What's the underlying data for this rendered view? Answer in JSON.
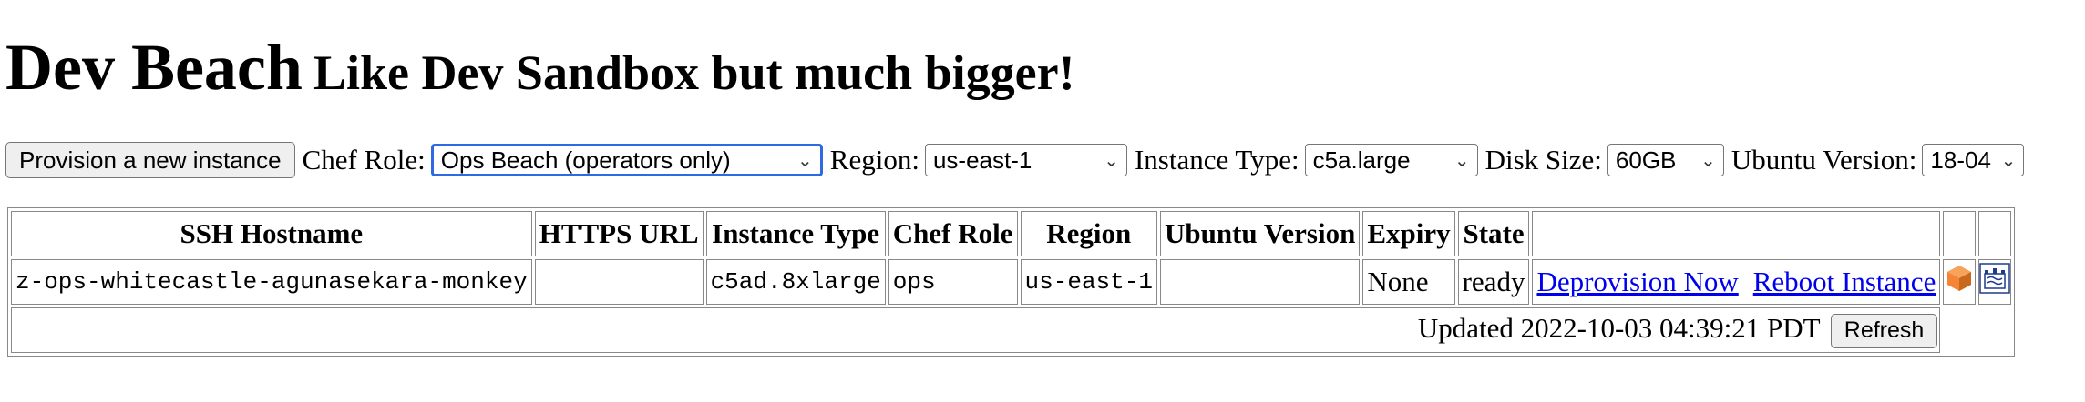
{
  "header": {
    "title": "Dev Beach",
    "subtitle": "Like Dev Sandbox but much bigger!"
  },
  "controls": {
    "provision_label": "Provision a new instance",
    "chef_role_label": "Chef Role:",
    "chef_role_value": "Ops Beach (operators only)",
    "region_label": "Region:",
    "region_value": "us-east-1",
    "instance_type_label": "Instance Type:",
    "instance_type_value": "c5a.large",
    "disk_size_label": "Disk Size:",
    "disk_size_value": "60GB",
    "ubuntu_version_label": "Ubuntu Version:",
    "ubuntu_version_value": "18-04"
  },
  "table": {
    "headers": [
      "SSH Hostname",
      "HTTPS URL",
      "Instance Type",
      "Chef Role",
      "Region",
      "Ubuntu Version",
      "Expiry",
      "State"
    ],
    "rows": [
      {
        "ssh_hostname": "z-ops-whitecastle-agunasekara-monkey",
        "https_url": "",
        "instance_type": "c5ad.8xlarge",
        "chef_role": "ops",
        "region": "us-east-1",
        "ubuntu_version": "",
        "expiry": "None",
        "state": "ready",
        "deprovision_label": "Deprovision Now",
        "reboot_label": "Reboot Instance",
        "icons": [
          "aws-ec2-icon",
          "white-castle-logo-icon"
        ]
      }
    ],
    "footer": {
      "updated_text": "Updated 2022-10-03 04:39:21 PDT",
      "refresh_label": "Refresh"
    }
  },
  "colors": {
    "link": "#0000ee",
    "focus_ring": "#2d6ae3",
    "ec2_orange": "#f58534",
    "castle_blue": "#1f3c8a"
  }
}
